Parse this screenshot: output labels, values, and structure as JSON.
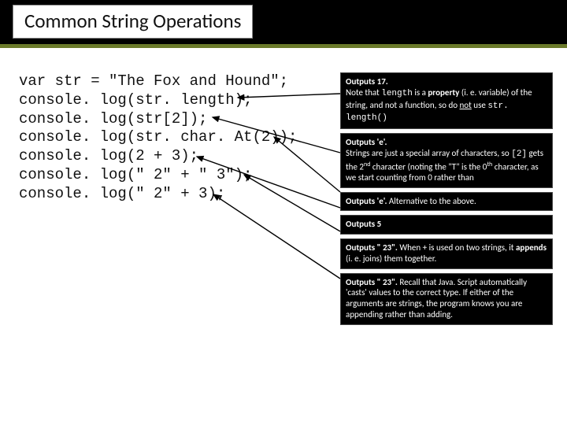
{
  "title": "Common String Operations",
  "code": {
    "l0": "var str = \"The Fox and Hound\";",
    "l1": "console. log(str. length);",
    "l2": "console. log(str[2]);",
    "l3": "console. log(str. char. At(2));",
    "l4": "console. log(2 + 3);",
    "l5": "console. log(\" 2\" + \" 3\");",
    "l6": "console. log(\" 2\" + 3);"
  },
  "boxes": {
    "b0": {
      "lead": "Outputs 17.",
      "t1": "Note that ",
      "mono": "length",
      "t2": " is a ",
      "bold": "property",
      "t3": " (i. e. variable) of the string, and not a function, so do ",
      "under": "not",
      "t4": " use ",
      "mono2": "str. length()"
    },
    "b1": {
      "lead": "Outputs 'e'.",
      "t1": "Strings are just a special array of characters, so ",
      "mono": "[2]",
      "t2": " gets the 2",
      "sup1": "nd",
      "t3": " character (noting the \"T\" is the 0",
      "sup2": "th",
      "t4": " character, as we start counting from 0 rather than"
    },
    "b2": {
      "lead": "Outputs 'e'.",
      "t1": " Alternative to the above."
    },
    "b3": {
      "lead": "Outputs 5"
    },
    "b4": {
      "lead": "Outputs \" 23\".",
      "t1": " When + is used on two strings, it ",
      "bold": "appends",
      "t2": " (i. e. joins) them together."
    },
    "b5": {
      "lead": "Outputs \" 23\".",
      "t1": " Recall that Java. Script automatically 'casts' values to the correct type. If either of the arguments are strings, the program knows you are appending rather than adding."
    }
  }
}
